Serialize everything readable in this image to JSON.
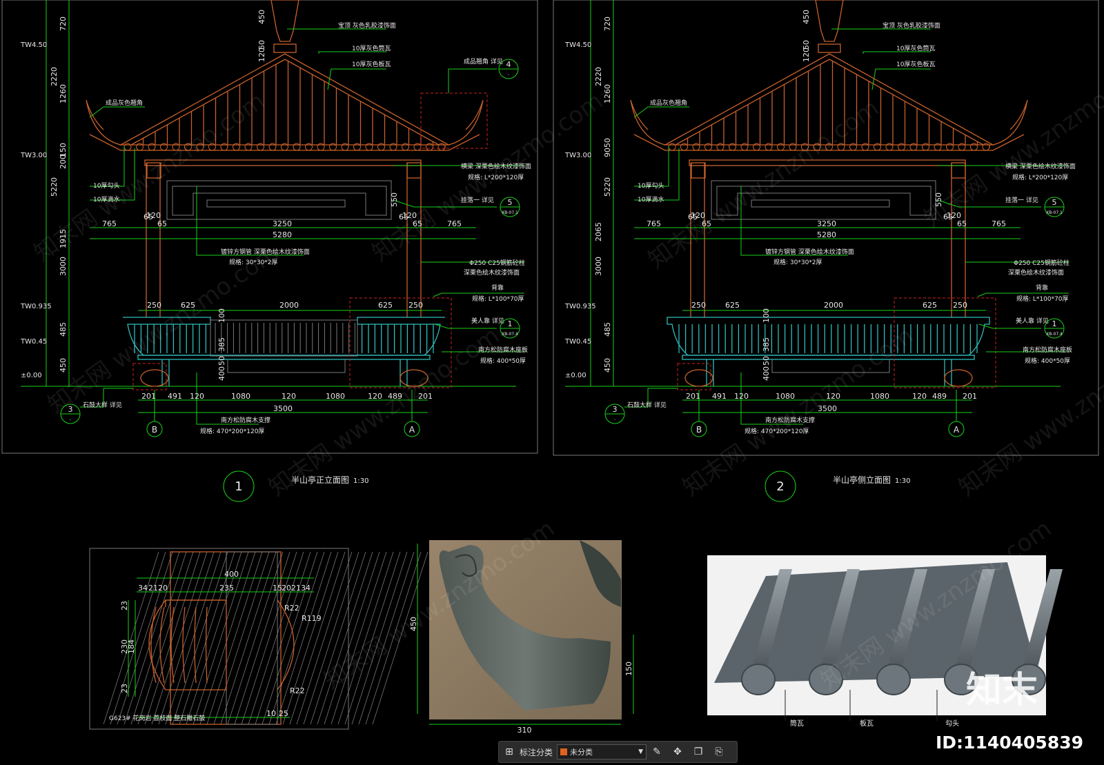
{
  "view1": {
    "title": "半山亭正立面图",
    "scale": "1:30",
    "number": "1",
    "levels": [
      "TW4.50",
      "TW3.00",
      "TW0.935",
      "TW0.45",
      "±0.00"
    ],
    "vdims": [
      "720",
      "2220",
      "1260",
      "150",
      "200",
      "5220",
      "1915",
      "3000",
      "485",
      "450"
    ],
    "vdims_top": [
      "450",
      "50",
      "120"
    ],
    "notes_top": [
      "宝顶 灰色乳胶漆饰面",
      "10厚灰色筒瓦",
      "10厚灰色板瓦",
      "成品翘角 详见",
      "成品灰色翘角"
    ],
    "notes_left": [
      "10厚勾头",
      "10厚滴水"
    ],
    "notes_right": [
      "横梁 深栗色绘木纹漆饰面",
      "规格: L*200*120厚",
      "挂落一 详见",
      "Φ250 C25钢筋砼柱",
      "深栗色绘木纹漆饰面",
      "背靠",
      "规格: L*100*70厚",
      "美人靠 详见",
      "南方松防腐木座板",
      "规格: 400*50厚"
    ],
    "notes_mid": [
      "镀锌方钢管 深栗色绘木纹漆饰面",
      "规格: 30*30*2厚"
    ],
    "hdims_upper": [
      "765",
      "65",
      "65",
      "3250",
      "65",
      "65",
      "765",
      "120",
      "120"
    ],
    "total_upper": "5280",
    "hdims_bench": [
      "250",
      "625",
      "2000",
      "625",
      "250"
    ],
    "bench_v": [
      "100",
      "385",
      "50",
      "400",
      "550"
    ],
    "hdims_bottom": [
      "201",
      "491",
      "120",
      "1080",
      "120",
      "1080",
      "120",
      "489",
      "201"
    ],
    "total_bottom": "3500",
    "bottom_note": [
      "南方松防腐木支撑",
      "规格: 470*200*120厚"
    ],
    "stone_note": "石鼓大样 详见",
    "axis": [
      "B",
      "A"
    ],
    "callouts": [
      {
        "n": "4",
        "s": "-"
      },
      {
        "n": "5",
        "s": "XB-07.1"
      },
      {
        "n": "1",
        "s": "XB-07.4"
      },
      {
        "n": "3",
        "s": "-"
      }
    ]
  },
  "view2": {
    "title": "半山亭侧立面图",
    "scale": "1:30",
    "number": "2",
    "levels": [
      "TW4.50",
      "TW3.00",
      "TW0.935",
      "TW0.45",
      "±0.00"
    ],
    "vdims": [
      "720",
      "2220",
      "1260",
      "9050",
      "5220",
      "2065",
      "3000",
      "485",
      "450"
    ],
    "vdims_top": [
      "450",
      "50",
      "120"
    ],
    "notes_top": [
      "宝顶 灰色乳胶漆饰面",
      "10厚灰色筒瓦",
      "10厚灰色板瓦",
      "成品灰色翘角"
    ],
    "notes_left": [
      "10厚勾头",
      "10厚滴水"
    ],
    "notes_right": [
      "横梁 深栗色绘木纹漆饰面",
      "规格: L*200*120厚",
      "挂落一 详见",
      "Φ250 C25钢筋砼柱",
      "深栗色绘木纹漆饰面",
      "背靠",
      "规格: L*100*70厚",
      "美人靠 详见",
      "南方松防腐木座板",
      "规格: 400*50厚"
    ],
    "notes_mid": [
      "镀锌方钢管 深栗色绘木纹漆饰面",
      "规格: 30*30*2厚"
    ],
    "hdims_upper": [
      "765",
      "65",
      "65",
      "3250",
      "65",
      "65",
      "765",
      "120",
      "120"
    ],
    "total_upper": "5280",
    "hdims_bench": [
      "250",
      "625",
      "2000",
      "625",
      "250"
    ],
    "bench_v": [
      "100",
      "385",
      "50",
      "400",
      "550"
    ],
    "hdims_bottom": [
      "201",
      "491",
      "120",
      "1080",
      "120",
      "1080",
      "120",
      "489",
      "201"
    ],
    "total_bottom": "3500",
    "bottom_note": [
      "南方松防腐木支撑",
      "规格: 470*200*120厚"
    ],
    "stone_note": "石鼓大样 详见",
    "axis": [
      "B",
      "A"
    ],
    "callouts": [
      {
        "n": "5",
        "s": "XB-07.1"
      },
      {
        "n": "1",
        "s": "XB-07.4"
      },
      {
        "n": "3",
        "s": "-"
      }
    ]
  },
  "detail_drum": {
    "dims_top": [
      "400",
      "34",
      "21",
      "20",
      "235",
      "15",
      "20",
      "21",
      "34"
    ],
    "dims_left": [
      "23",
      "230",
      "184",
      "23"
    ],
    "radii": [
      "R22",
      "R119",
      "R22"
    ],
    "dims_bottom": [
      "10",
      "25"
    ],
    "note": "G623# 花岗岩 荔枝面 整石雕石鼓"
  },
  "photo_corner": {
    "dim_left": "450",
    "dim_right": "150",
    "dim_bottom": "310"
  },
  "photo_tiles": {
    "label_1": "筒瓦",
    "label_2": "板瓦",
    "label_3": "勾头"
  },
  "toolbar": {
    "label": "标注分类",
    "select_value": "未分类",
    "swatch_color": "#e0621f"
  },
  "id_tag": "ID:1140405839",
  "logo_text": "知末",
  "watermark": "知末网 www.znzmo.com"
}
